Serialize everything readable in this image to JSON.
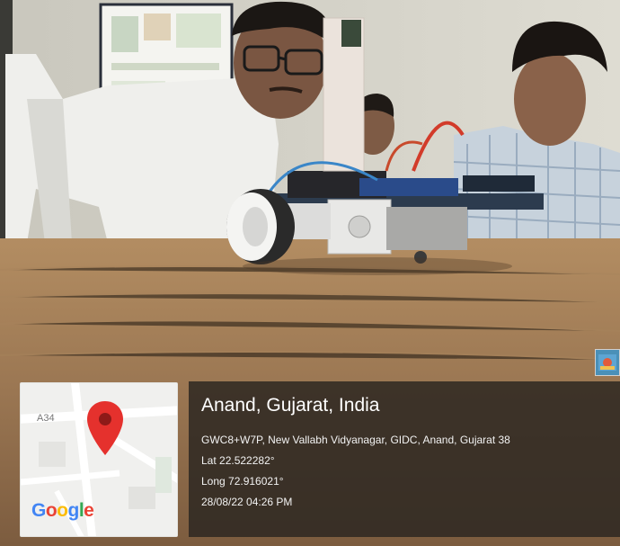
{
  "overlay": {
    "location_title": "Anand, Gujarat, India",
    "address": "GWC8+W7P, New Vallabh Vidyanagar, GIDC, Anand, Gujarat 38",
    "latitude": "Lat 22.522282°",
    "longitude": "Long 72.916021°",
    "datetime": "28/08/22 04:26 PM"
  },
  "map": {
    "road_label": "A34",
    "logo": {
      "g": "G",
      "o1": "o",
      "o2": "o",
      "g2": "g",
      "l": "l",
      "e": "e"
    }
  }
}
